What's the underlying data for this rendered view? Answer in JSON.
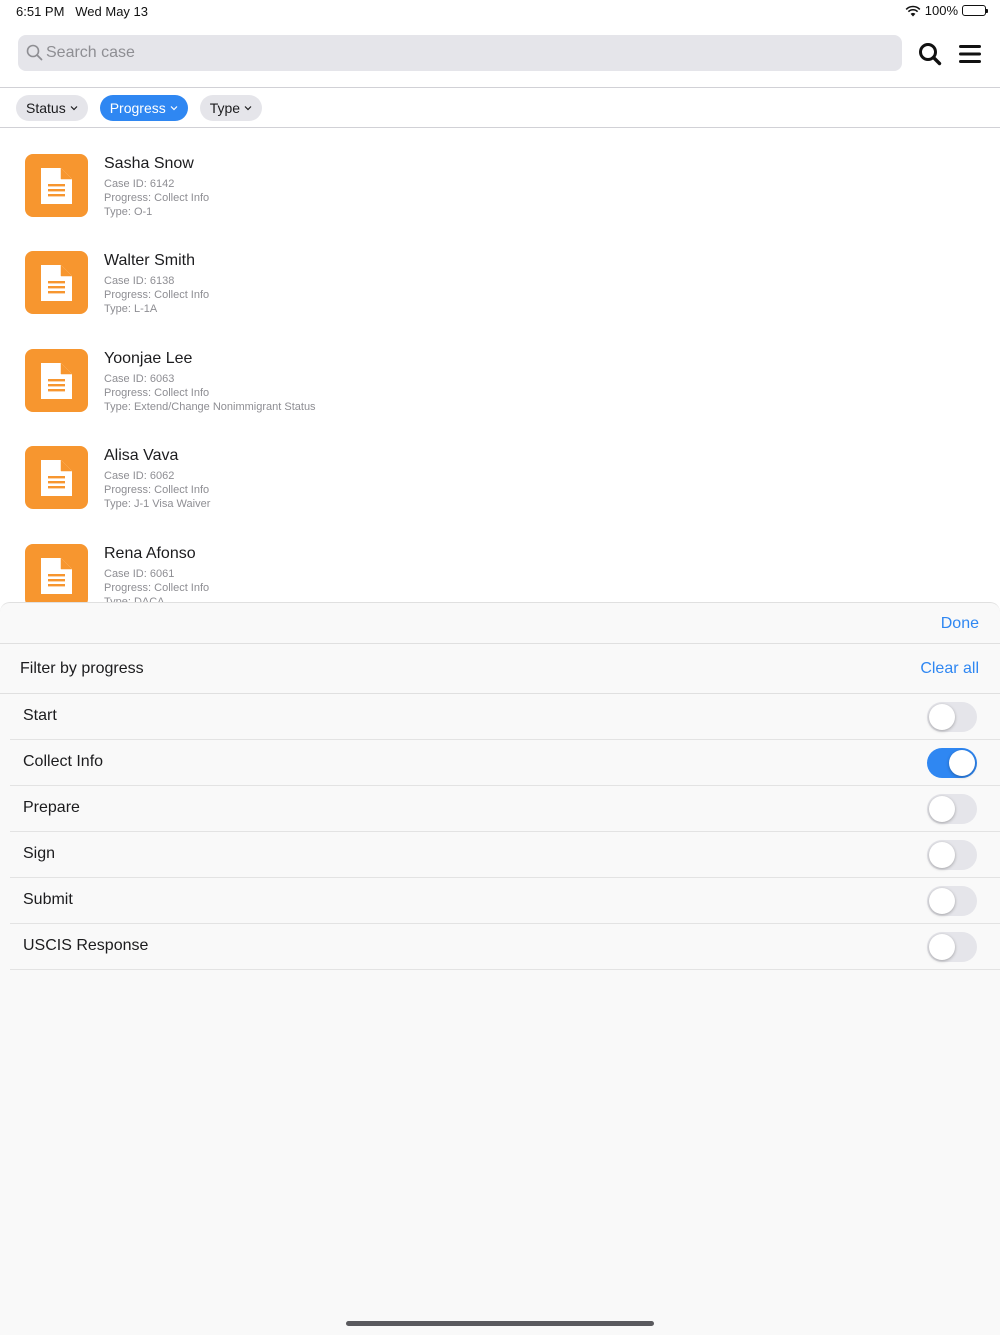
{
  "status_bar": {
    "time": "6:51 PM",
    "date": "Wed May 13",
    "battery": "100%"
  },
  "search": {
    "placeholder": "Search case",
    "value": ""
  },
  "filters": [
    {
      "label": "Status",
      "active": false
    },
    {
      "label": "Progress",
      "active": true
    },
    {
      "label": "Type",
      "active": false
    }
  ],
  "cases": [
    {
      "name": "Sasha Snow",
      "case_id": "Case ID: 6142",
      "progress": "Progress: Collect Info",
      "type": "Type: O-1"
    },
    {
      "name": "Walter Smith",
      "case_id": "Case ID: 6138",
      "progress": "Progress: Collect Info",
      "type": "Type: L-1A"
    },
    {
      "name": "Yoonjae Lee",
      "case_id": "Case ID: 6063",
      "progress": "Progress: Collect Info",
      "type": "Type: Extend/Change Nonimmigrant Status"
    },
    {
      "name": "Alisa Vava",
      "case_id": "Case ID: 6062",
      "progress": "Progress: Collect Info",
      "type": "Type: J-1 Visa Waiver"
    },
    {
      "name": "Rena Afonso",
      "case_id": "Case ID: 6061",
      "progress": "Progress: Collect Info",
      "type": "Type: DACA"
    }
  ],
  "sheet": {
    "done_label": "Done",
    "title": "Filter by progress",
    "clear_label": "Clear all",
    "options": [
      {
        "label": "Start",
        "on": false
      },
      {
        "label": "Collect Info",
        "on": true
      },
      {
        "label": "Prepare",
        "on": false
      },
      {
        "label": "Sign",
        "on": false
      },
      {
        "label": "Submit",
        "on": false
      },
      {
        "label": "USCIS Response",
        "on": false
      }
    ]
  },
  "colors": {
    "accent": "#2f87f2",
    "doc_icon": "#f7962f",
    "chip": "#e5e5ea"
  }
}
